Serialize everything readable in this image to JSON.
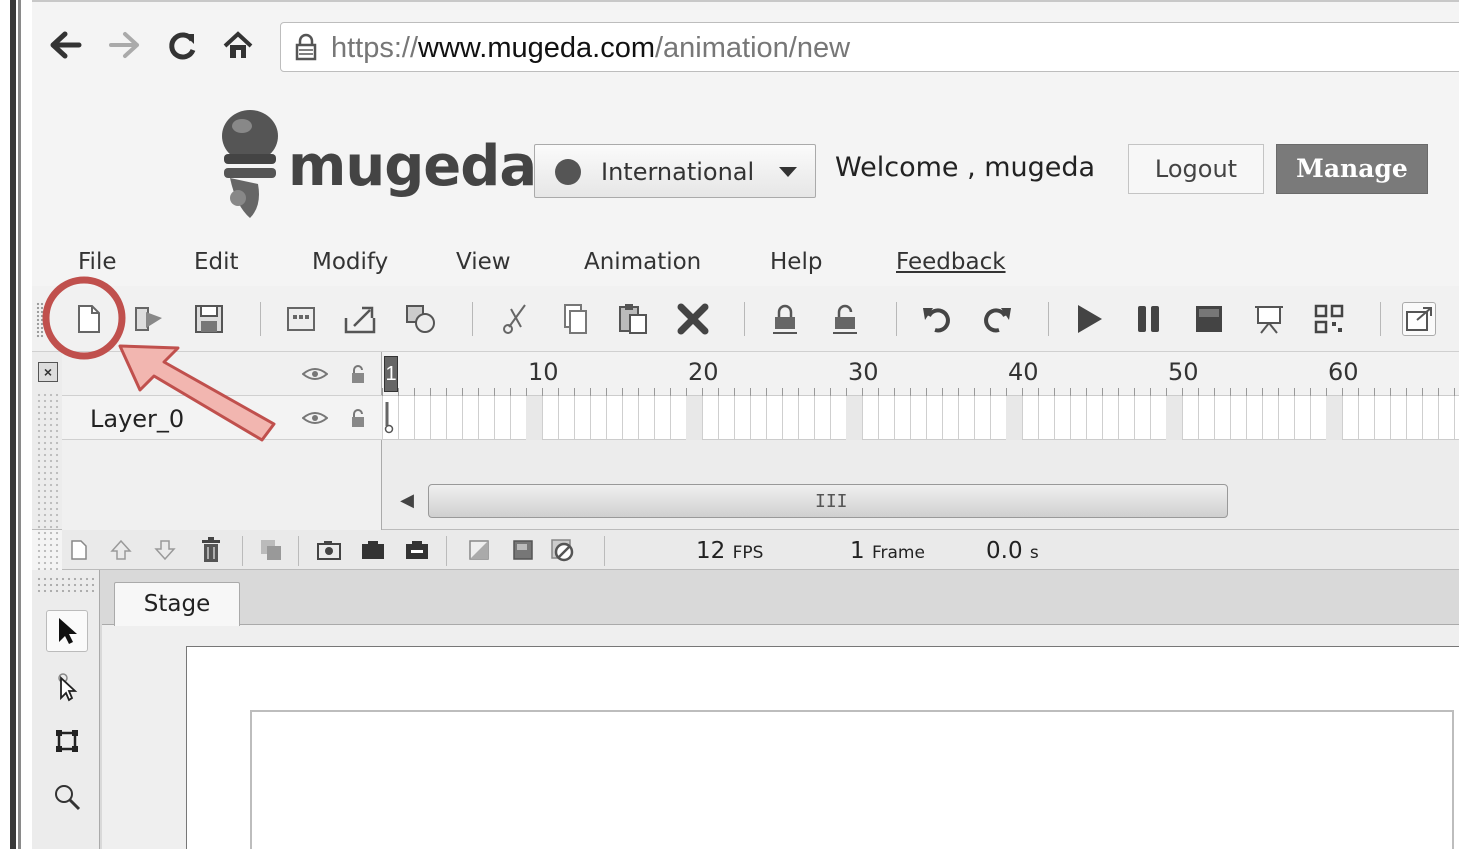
{
  "browser": {
    "back_icon": "arrow-left-icon",
    "forward_icon": "arrow-right-icon",
    "reload_icon": "reload-icon",
    "home_icon": "home-icon",
    "url_scheme": "https://",
    "url_host": "www.mugeda.com",
    "url_path": "/animation/new"
  },
  "header": {
    "logo_text": "mugeda",
    "language": "International",
    "welcome": "Welcome , mugeda",
    "logout_label": "Logout",
    "manage_label": "Manage"
  },
  "menu": {
    "items": [
      "File",
      "Edit",
      "Modify",
      "View",
      "Animation",
      "Help",
      "Feedback"
    ]
  },
  "toolbar": {
    "icons": [
      "new-file-icon",
      "open-icon",
      "save-icon",
      "symbol-icon",
      "export-icon",
      "convert-icon",
      "cut-icon",
      "copy-icon",
      "paste-icon",
      "delete-icon",
      "lock-icon",
      "unlock-icon",
      "undo-icon",
      "redo-icon",
      "play-icon",
      "pause-icon",
      "stop-icon",
      "presentation-icon",
      "qr-code-icon",
      "popout-icon"
    ]
  },
  "timeline": {
    "ruler_labels": [
      "1",
      "10",
      "20",
      "30",
      "40",
      "50",
      "60"
    ],
    "layers": [
      {
        "name": "Layer_0"
      }
    ],
    "scroll_grip": "III",
    "fps_value": "12",
    "fps_unit": "FPS",
    "frame_value": "1",
    "frame_unit": "Frame",
    "time_value": "0.0",
    "time_unit": "s"
  },
  "stage": {
    "tab_label": "Stage"
  },
  "tools": {
    "items": [
      "select-arrow-icon",
      "subselect-arrow-icon",
      "transform-icon",
      "zoom-icon"
    ]
  },
  "annotation": {
    "highlight_color": "#c0504d",
    "arrow_fill": "#f2b6b0"
  }
}
